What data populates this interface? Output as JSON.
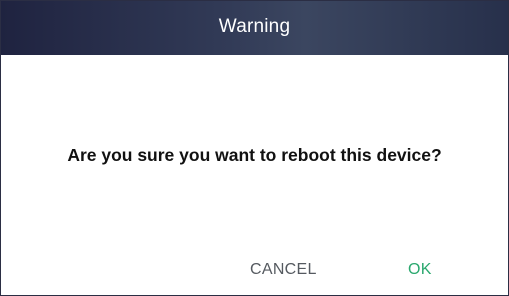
{
  "dialog": {
    "title": "Warning",
    "message": "Are you sure you want to reboot this device?",
    "buttons": {
      "cancel_label": "CANCEL",
      "ok_label": "OK"
    }
  },
  "colors": {
    "header_background": "#2b3350",
    "header_text": "#ffffff",
    "message_text": "#111111",
    "cancel_text": "#555a60",
    "ok_text": "#2aa86e"
  }
}
